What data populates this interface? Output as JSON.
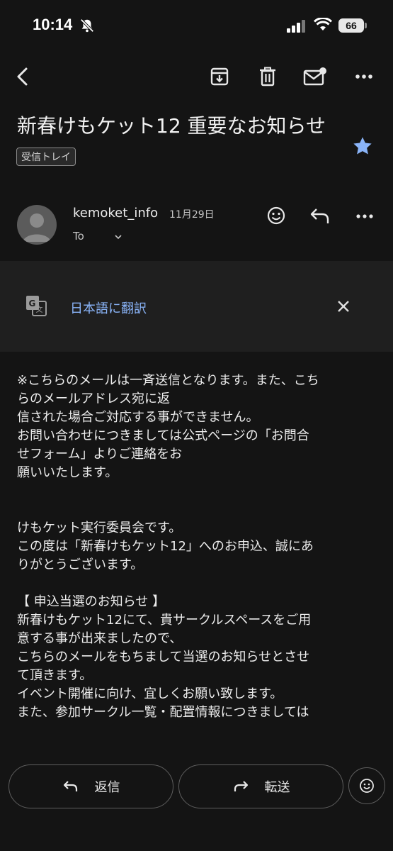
{
  "status_bar": {
    "time": "10:14",
    "battery": "66"
  },
  "toolbar": {
    "icons": [
      "back-arrow-icon",
      "archive-icon",
      "trash-icon",
      "mark-unread-icon",
      "more-icon"
    ]
  },
  "email": {
    "subject": "新春けもケット12 重要なお知らせ",
    "label": "受信トレイ",
    "sender": "kemoket_info",
    "date": "11月29日",
    "to": "To"
  },
  "translate": {
    "link": "日本語に翻訳"
  },
  "body_lines": [
    "※こちらのメールは一斉送信となります。また、こち",
    "らのメールアドレス宛に返",
    "信された場合ご対応する事ができません。",
    "お問い合わせにつきましては公式ページの「お問合",
    "せフォーム」よりご連絡をお",
    "願いいたします。",
    "",
    "",
    "けもケット実行委員会です。",
    "この度は「新春けもケット12」へのお申込、誠にあ",
    "りがとうございます。",
    "",
    "【 申込当選のお知らせ 】",
    "新春けもケット12にて、貴サークルスペースをご用",
    "意する事が出来ましたので、",
    "こちらのメールをもちまして当選のお知らせとさせ",
    "て頂きます。",
    "イベント開催に向け、宜しくお願い致します。",
    "また、参加サークル一覧・配置情報につきましては"
  ],
  "actions": {
    "reply": "返信",
    "forward": "転送"
  },
  "colors": {
    "background": "#141414",
    "accent_link": "#8ab4f8",
    "star": "#8ab4f8"
  }
}
